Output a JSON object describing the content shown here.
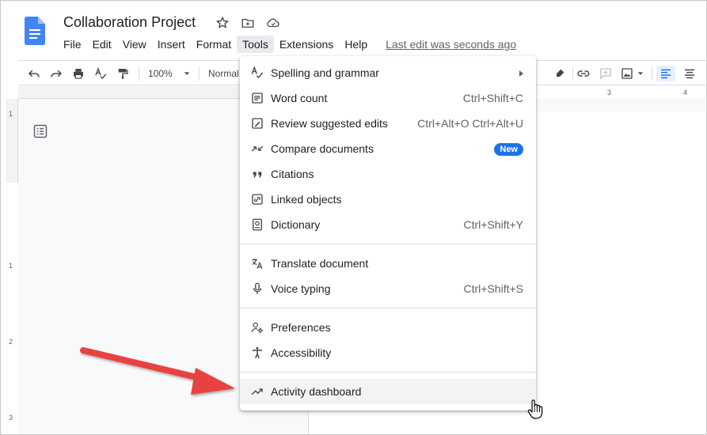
{
  "document": {
    "title": "Collaboration Project"
  },
  "menubar": {
    "items": [
      {
        "label": "File"
      },
      {
        "label": "Edit"
      },
      {
        "label": "View"
      },
      {
        "label": "Insert"
      },
      {
        "label": "Format"
      },
      {
        "label": "Tools"
      },
      {
        "label": "Extensions"
      },
      {
        "label": "Help"
      }
    ],
    "last_edit": "Last edit was seconds ago"
  },
  "toolbar": {
    "zoom": "100%",
    "style": "Normal"
  },
  "ruler": {
    "top_marks": [
      "3",
      "4"
    ],
    "left_marks": [
      "1",
      "1",
      "2",
      "3"
    ]
  },
  "tools_menu": {
    "groups": [
      [
        {
          "label": "Spelling and grammar",
          "icon": "spellcheck-icon",
          "submenu": true
        },
        {
          "label": "Word count",
          "icon": "word-count-icon",
          "shortcut": "Ctrl+Shift+C"
        },
        {
          "label": "Review suggested edits",
          "icon": "review-edits-icon",
          "shortcut": "Ctrl+Alt+O Ctrl+Alt+U"
        },
        {
          "label": "Compare documents",
          "icon": "compare-icon",
          "badge": "New"
        },
        {
          "label": "Citations",
          "icon": "quote-icon"
        },
        {
          "label": "Linked objects",
          "icon": "link-objects-icon"
        },
        {
          "label": "Dictionary",
          "icon": "dictionary-icon",
          "shortcut": "Ctrl+Shift+Y"
        }
      ],
      [
        {
          "label": "Translate document",
          "icon": "translate-icon"
        },
        {
          "label": "Voice typing",
          "icon": "microphone-icon",
          "shortcut": "Ctrl+Shift+S"
        }
      ],
      [
        {
          "label": "Preferences",
          "icon": "preferences-icon"
        },
        {
          "label": "Accessibility",
          "icon": "accessibility-icon"
        }
      ],
      [
        {
          "label": "Activity dashboard",
          "icon": "trending-up-icon",
          "hovered": true
        }
      ]
    ]
  },
  "colors": {
    "accent": "#1a73e8",
    "arrow": "#e8423f",
    "docs_blue": "#4285f4"
  }
}
